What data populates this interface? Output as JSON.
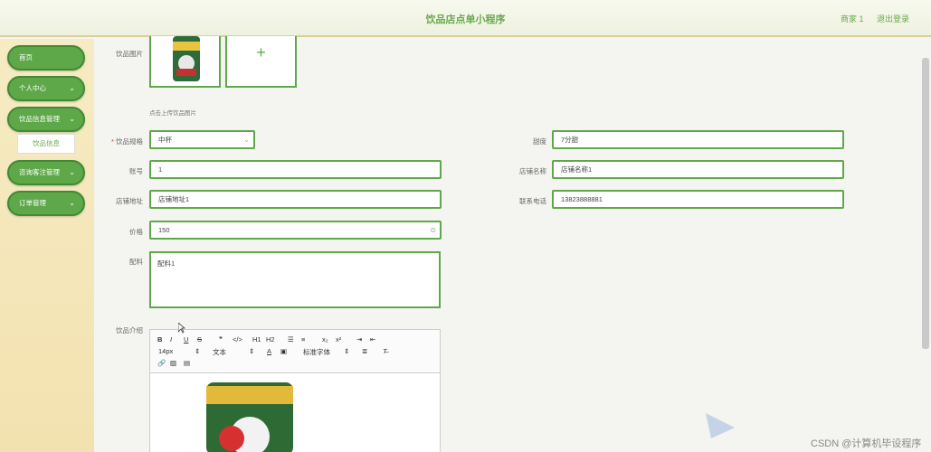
{
  "header": {
    "title": "饮品店点单小程序",
    "user": "商家 1",
    "logout": "退出登录"
  },
  "sidebar": {
    "items": [
      {
        "label": "首页"
      },
      {
        "label": "个人中心"
      },
      {
        "label": "饮品信息管理"
      },
      {
        "label": "咨询客注管理"
      },
      {
        "label": "订单管理"
      }
    ],
    "submenu": "饮品信息"
  },
  "form": {
    "image_label": "饮品图片",
    "upload_hint": "点击上传饮品图片",
    "spec_label": "饮品规格",
    "spec_value": "中杯",
    "sweetness_label": "甜度",
    "sweetness_value": "7分甜",
    "account_label": "账号",
    "account_value": "1",
    "shop_name_label": "店铺名称",
    "shop_name_value": "店铺名称1",
    "shop_address_label": "店铺地址",
    "shop_address_value": "店铺地址1",
    "phone_label": "联系电话",
    "phone_value": "13823888881",
    "price_label": "价格",
    "price_value": "150",
    "ingredients_label": "配料",
    "ingredients_value": "配料1",
    "intro_label": "饮品介绍"
  },
  "editor": {
    "font_size": "14px",
    "text_type": "文本",
    "font_family": "标准字体",
    "buttons": [
      "B",
      "I",
      "U",
      "S",
      "❞",
      "</>",
      "H1",
      "H2",
      "x₂",
      "x²",
      "A"
    ]
  },
  "watermark": "CSDN @计算机毕设程序",
  "colors": {
    "accent": "#5ea84a",
    "title": "#6aa84f"
  }
}
